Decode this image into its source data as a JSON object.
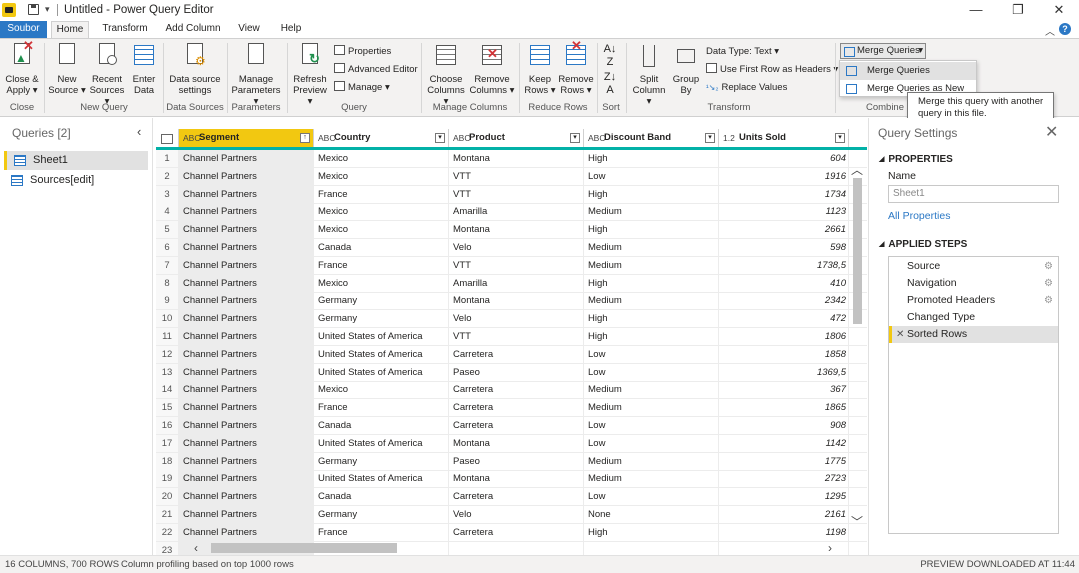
{
  "titlebar": {
    "title": "Untitled - Power Query Editor"
  },
  "tabs": {
    "file": "Soubor",
    "home": "Home",
    "transform": "Transform",
    "add_column": "Add Column",
    "view": "View",
    "help": "Help"
  },
  "ribbon": {
    "close_apply": "Close &",
    "close_apply2": "Apply",
    "new_source": "New",
    "new_source2": "Source",
    "recent_sources": "Recent",
    "recent_sources2": "Sources",
    "enter_data": "Enter",
    "enter_data2": "Data",
    "data_source_settings": "Data source",
    "data_source_settings2": "settings",
    "manage_parameters": "Manage",
    "manage_parameters2": "Parameters",
    "refresh_preview": "Refresh",
    "refresh_preview2": "Preview",
    "properties": "Properties",
    "advanced_editor": "Advanced Editor",
    "manage": "Manage",
    "choose_columns": "Choose",
    "choose_columns2": "Columns",
    "remove_columns": "Remove",
    "remove_columns2": "Columns",
    "keep_rows": "Keep",
    "keep_rows2": "Rows",
    "remove_rows": "Remove",
    "remove_rows2": "Rows",
    "split_column": "Split",
    "split_column2": "Column",
    "group_by": "Group",
    "group_by2": "By",
    "data_type": "Data Type: Text",
    "first_row_headers": "Use First Row as Headers",
    "replace_values": "Replace Values",
    "merge_queries": "Merge Queries",
    "groups": {
      "close": "Close",
      "new_query": "New Query",
      "data_sources": "Data Sources",
      "parameters": "Parameters",
      "query": "Query",
      "manage_columns": "Manage Columns",
      "reduce_rows": "Reduce Rows",
      "sort": "Sort",
      "transform": "Transform",
      "combine": "Combine"
    }
  },
  "merge_menu": {
    "items": [
      "Merge Queries",
      "Merge Queries as New"
    ],
    "tooltip_line1": "Merge this query with another",
    "tooltip_line2": "query in this file."
  },
  "queries": {
    "header": "Queries [2]",
    "items": [
      "Sheet1",
      "Sources[edit]"
    ]
  },
  "grid": {
    "columns": [
      {
        "type": "ABC",
        "name": "Segment"
      },
      {
        "type": "ABC",
        "name": "Country"
      },
      {
        "type": "ABC",
        "name": "Product"
      },
      {
        "type": "ABC",
        "name": "Discount Band"
      },
      {
        "type": "1.2",
        "name": "Units Sold"
      }
    ],
    "rows": [
      [
        "1",
        "Channel Partners",
        "Mexico",
        "Montana",
        "High",
        "604"
      ],
      [
        "2",
        "Channel Partners",
        "Mexico",
        "VTT",
        "Low",
        "1916"
      ],
      [
        "3",
        "Channel Partners",
        "France",
        "VTT",
        "High",
        "1734"
      ],
      [
        "4",
        "Channel Partners",
        "Mexico",
        "Amarilla",
        "Medium",
        "1123"
      ],
      [
        "5",
        "Channel Partners",
        "Mexico",
        "Montana",
        "High",
        "2661"
      ],
      [
        "6",
        "Channel Partners",
        "Canada",
        "Velo",
        "Medium",
        "598"
      ],
      [
        "7",
        "Channel Partners",
        "France",
        "VTT",
        "Medium",
        "1738,5"
      ],
      [
        "8",
        "Channel Partners",
        "Mexico",
        "Amarilla",
        "High",
        "410"
      ],
      [
        "9",
        "Channel Partners",
        "Germany",
        "Montana",
        "Medium",
        "2342"
      ],
      [
        "10",
        "Channel Partners",
        "Germany",
        "Velo",
        "High",
        "472"
      ],
      [
        "11",
        "Channel Partners",
        "United States of America",
        "VTT",
        "High",
        "1806"
      ],
      [
        "12",
        "Channel Partners",
        "United States of America",
        "Carretera",
        "Low",
        "1858"
      ],
      [
        "13",
        "Channel Partners",
        "United States of America",
        "Paseo",
        "Low",
        "1369,5"
      ],
      [
        "14",
        "Channel Partners",
        "Mexico",
        "Carretera",
        "Medium",
        "367"
      ],
      [
        "15",
        "Channel Partners",
        "France",
        "Carretera",
        "Medium",
        "1865"
      ],
      [
        "16",
        "Channel Partners",
        "Canada",
        "Carretera",
        "Low",
        "908"
      ],
      [
        "17",
        "Channel Partners",
        "United States of America",
        "Montana",
        "Low",
        "1142"
      ],
      [
        "18",
        "Channel Partners",
        "Germany",
        "Paseo",
        "Medium",
        "1775"
      ],
      [
        "19",
        "Channel Partners",
        "United States of America",
        "Montana",
        "Medium",
        "2723"
      ],
      [
        "20",
        "Channel Partners",
        "Canada",
        "Carretera",
        "Low",
        "1295"
      ],
      [
        "21",
        "Channel Partners",
        "Germany",
        "Velo",
        "None",
        "2161"
      ],
      [
        "22",
        "Channel Partners",
        "France",
        "Carretera",
        "High",
        "1198"
      ],
      [
        "23",
        "",
        "",
        "",
        "",
        ""
      ]
    ]
  },
  "settings": {
    "title": "Query Settings",
    "properties": "PROPERTIES",
    "name_label": "Name",
    "name_value": "Sheet1",
    "all_properties": "All Properties",
    "applied_steps": "APPLIED STEPS",
    "steps": [
      "Source",
      "Navigation",
      "Promoted Headers",
      "Changed Type",
      "Sorted Rows"
    ]
  },
  "status": {
    "columns_rows": "16 COLUMNS, 700 ROWS",
    "profiling": "Column profiling based on top 1000 rows",
    "preview": "PREVIEW DOWNLOADED AT 11:44"
  },
  "colors": {
    "accent": "#2b78c5",
    "selected_header": "#f2c811",
    "teal": "#02b1a7"
  }
}
